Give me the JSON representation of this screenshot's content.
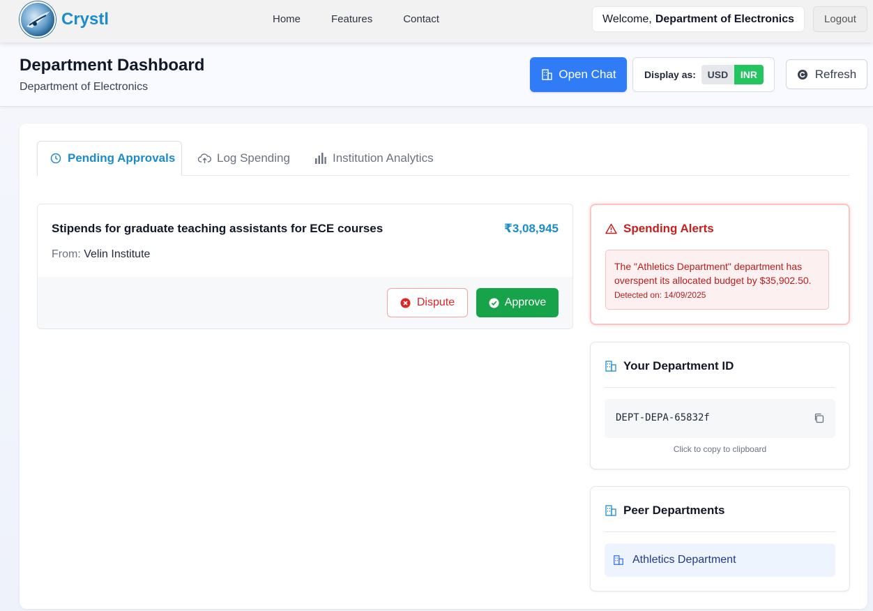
{
  "nav": {
    "brand": "Crystl",
    "links": {
      "home": "Home",
      "features": "Features",
      "contact": "Contact"
    },
    "welcome_prefix": "Welcome,",
    "welcome_name": "Department of Electronics",
    "logout": "Logout"
  },
  "header": {
    "title": "Department Dashboard",
    "subtitle": "Department of Electronics",
    "open_chat": "Open Chat",
    "display_as": "Display as:",
    "currency_usd": "USD",
    "currency_inr": "INR",
    "selected_currency": "INR",
    "refresh": "Refresh"
  },
  "tabs": {
    "pending": "Pending Approvals",
    "log": "Log Spending",
    "analytics": "Institution Analytics",
    "active": "Pending Approvals"
  },
  "approval": {
    "title": "Stipends for graduate teaching assistants for ECE courses",
    "amount": "₹3,08,945",
    "from_label": "From:",
    "from_value": "Velin Institute",
    "dispute": "Dispute",
    "approve": "Approve"
  },
  "alerts": {
    "title": "Spending Alerts",
    "message": "The \"Athletics Department\" department has overspent its allocated budget by $35,902.50.",
    "detected": "Detected on: 14/09/2025"
  },
  "department_id": {
    "title": "Your Department ID",
    "value": "DEPT-DEPA-65832f",
    "hint": "Click to copy to clipboard"
  },
  "peers": {
    "title": "Peer Departments",
    "items": [
      "Athletics Department"
    ]
  },
  "colors": {
    "brand": "#1a8ccc",
    "primary_button": "#2f7cf6",
    "approve": "#16a34a",
    "dispute": "#dc2626",
    "alert": "#c81e1e",
    "inr_active": "#22c55e"
  },
  "icons": {
    "logo": "crystl-logo-icon",
    "chat": "building-icon",
    "refresh": "refresh-icon",
    "pending": "clock-icon",
    "log": "cloud-upload-icon",
    "analytics": "bar-chart-icon",
    "dispute": "x-circle-icon",
    "approve": "check-circle-icon",
    "alert": "warning-triangle-icon",
    "dept": "building-icon",
    "copy": "copy-icon",
    "peer": "building-icon"
  }
}
